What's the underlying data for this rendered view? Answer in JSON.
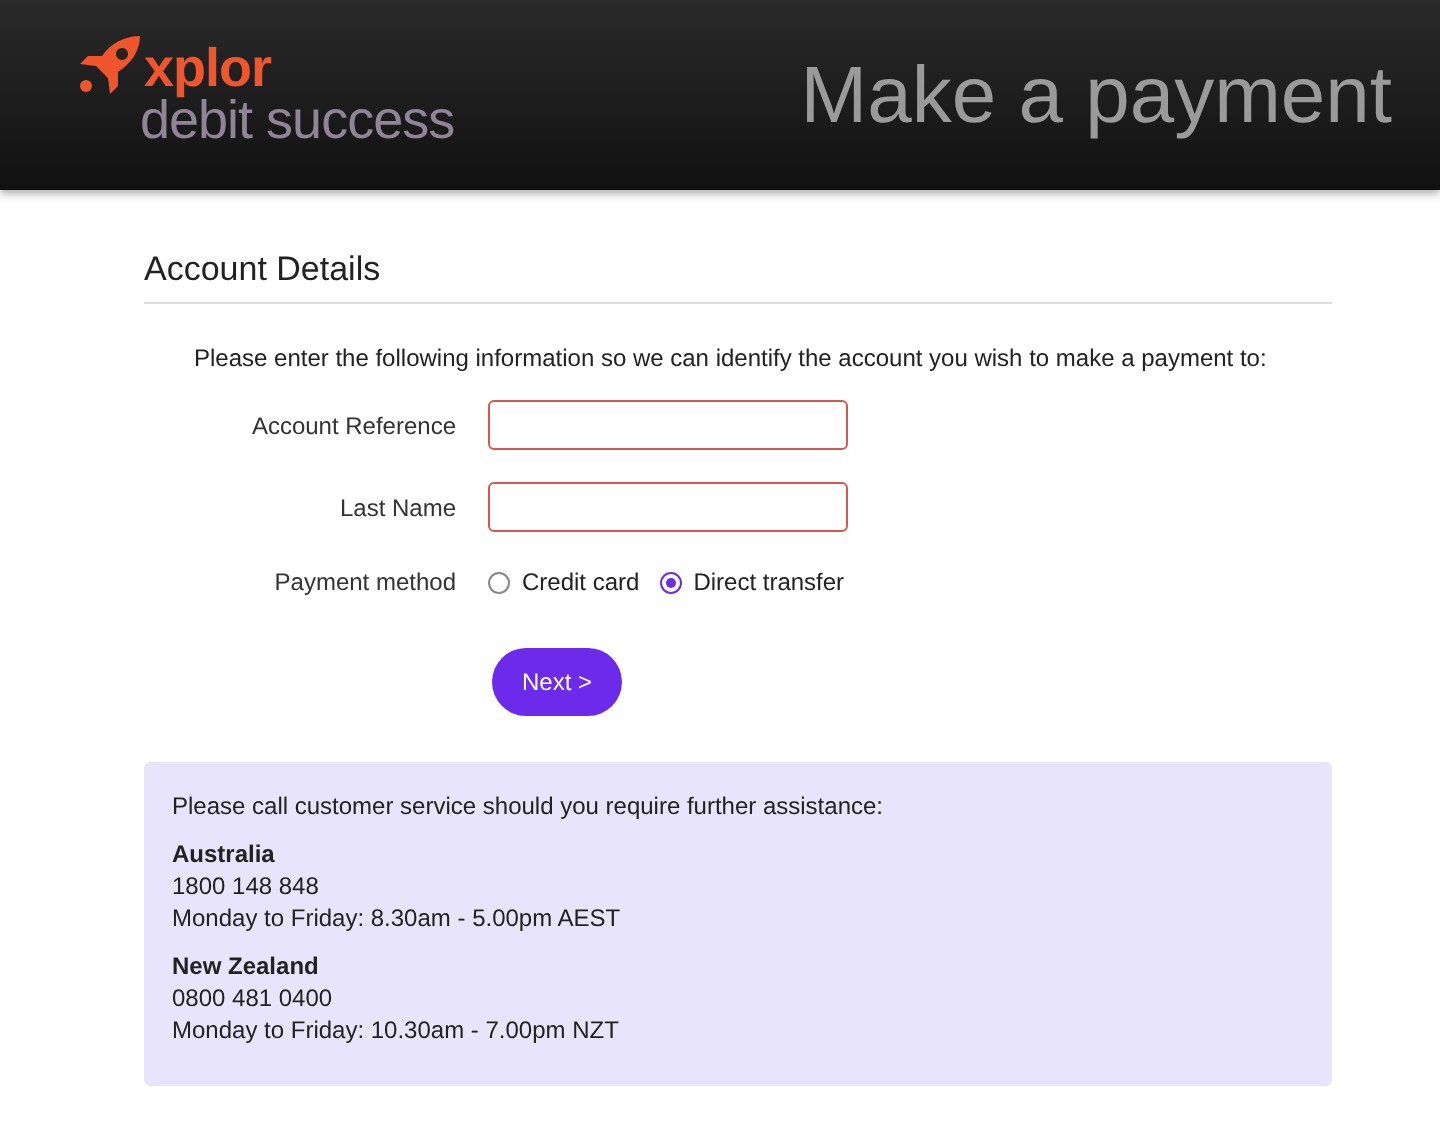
{
  "header": {
    "logo_top": "xplor",
    "logo_bottom": "debit success",
    "title": "Make a payment"
  },
  "section_title": "Account Details",
  "intro": "Please enter the following information so we can identify the account you wish to make a payment to:",
  "fields": [
    {
      "label": "Account Reference",
      "invalid": true
    },
    {
      "label": "Last Name",
      "invalid": true
    }
  ],
  "payment_method": {
    "label": "Payment method",
    "options": [
      {
        "label": "Credit card",
        "selected": false
      },
      {
        "label": "Direct transfer",
        "selected": true
      }
    ]
  },
  "next_button": "Next >",
  "help": {
    "intro": "Please call customer service should you require further assistance:",
    "regions": [
      {
        "name": "Australia",
        "phone": "1800 148 848",
        "hours": "Monday to Friday: 8.30am - 5.00pm AEST"
      },
      {
        "name": "New Zealand",
        "phone": "0800 481 0400",
        "hours": "Monday to Friday: 10.30am - 7.00pm NZT"
      }
    ]
  }
}
